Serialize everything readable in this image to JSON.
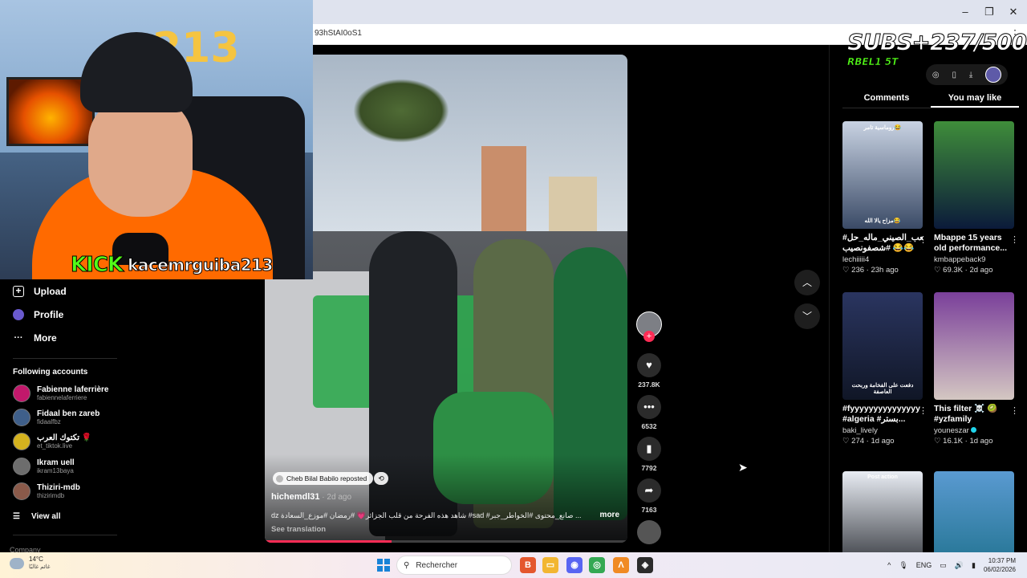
{
  "browser": {
    "url": "93hStAI0oS1",
    "window_controls": [
      "–",
      "❐",
      "✕"
    ]
  },
  "stream": {
    "platform": "KICK",
    "channel": "kacemrguiba213",
    "balloon_text": "213",
    "subs_counter": "SUBS+237/500",
    "subs_label": "RBEL1 5T"
  },
  "sidebar": {
    "nav": [
      {
        "label": "Upload",
        "icon": "upload-icon"
      },
      {
        "label": "Profile",
        "icon": "profile-avatar-icon"
      },
      {
        "label": "More",
        "icon": "more-dots-icon"
      }
    ],
    "following_header": "Following accounts",
    "accounts": [
      {
        "name": "Fabienne laferrière",
        "handle": "fabiennelaferriere"
      },
      {
        "name": "Fidaal ben zareb",
        "handle": "fidaalfbz"
      },
      {
        "name": "تكتوك العرب 🌹",
        "handle": "et_tiktok.live"
      },
      {
        "name": "Ikram uell",
        "handle": "ikram13baya"
      },
      {
        "name": "Thiziri-mdb",
        "handle": "thizirimdb"
      }
    ],
    "view_all": "View all",
    "company": "Company"
  },
  "video": {
    "repost_text": "Cheb Bilal Babilo reposted",
    "author": "hichemdl31",
    "date": " · 2d ago",
    "caption": "dz شاهد هذه الفرحة من قلب الجزائر💗 #رمضان #موزع_السعادة #sad #صانع_محتوى #الخواطر_جبر ...",
    "more_label": "more",
    "translate_label": "See translation",
    "progress": 0.35
  },
  "actions": {
    "likes": "237.8K",
    "comments": "6532",
    "saves": "7792",
    "shares": "7163"
  },
  "panel": {
    "tabs": [
      "Comments",
      "You may like"
    ],
    "active_tab": "You may like",
    "cards": [
      {
        "title": "#الشعب_الصيني_ماله_حل #شصفونصيب 😂😂 ...",
        "author": "lechiiiii4",
        "likes": "236",
        "time": "23h ago",
        "thumb_top": "روماسية تامر😂",
        "thumb_bottom": "مزاح يالا الله😂",
        "colors": [
          "#c9d3e3",
          "#3a4a66"
        ]
      },
      {
        "title": "Mbappe 15 years old performance...",
        "author": "kmbappeback9",
        "likes": "69.3K",
        "time": "2d ago",
        "thumb_top": "",
        "thumb_bottom": "",
        "colors": [
          "#3f8d3a",
          "#0b1a3a"
        ]
      },
      {
        "title": "#fyyyyyyyyyyyyyyy #algeria #بستر...",
        "author": "baki_lively",
        "likes": "274",
        "time": "1d ago",
        "thumb_top": "",
        "thumb_bottom": "دفعت على الفخامة وربحت العاصفة",
        "colors": [
          "#2a3560",
          "#101626"
        ]
      },
      {
        "title": "This filter ☠️ 🥝 #yzfamily",
        "author": "youneszar",
        "likes": "16.1K",
        "time": "1d ago",
        "thumb_top": "",
        "thumb_bottom": "",
        "colors": [
          "#7a3f9a",
          "#d4c7c2"
        ]
      },
      {
        "title": "",
        "author": "",
        "likes": "",
        "time": "",
        "thumb_top": "Post action",
        "thumb_bottom": "",
        "colors": [
          "#e9edf4",
          "#1f2228"
        ]
      },
      {
        "title": "",
        "author": "",
        "likes": "",
        "time": "",
        "thumb_top": "",
        "thumb_bottom": "",
        "colors": [
          "#5a9ad1",
          "#1c6f8a"
        ]
      }
    ]
  },
  "taskbar": {
    "temp": "14°C",
    "condition": "غائم غالبًا",
    "search_placeholder": "Rechercher",
    "lang": "ENG",
    "time": "10:37 PM",
    "date": "06/02/2026"
  },
  "colors": {
    "accent": "#fe2c55",
    "kick_green": "#53fc18"
  }
}
